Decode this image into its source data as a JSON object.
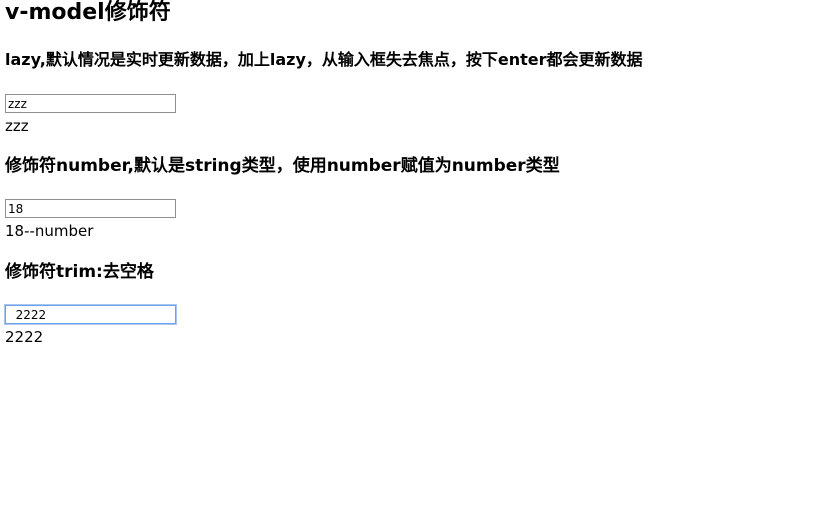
{
  "title": "v-model修饰符",
  "sections": [
    {
      "heading": "lazy,默认情况是实时更新数据，加上lazy，从输入框失去焦点，按下enter都会更新数据",
      "input_value": "zzz",
      "output": "zzz"
    },
    {
      "heading": "修饰符number,默认是string类型，使用number赋值为number类型",
      "input_value": "18",
      "output": "18--number"
    },
    {
      "heading": "修饰符trim:去空格",
      "input_value": "  2222",
      "output": "2222"
    }
  ]
}
